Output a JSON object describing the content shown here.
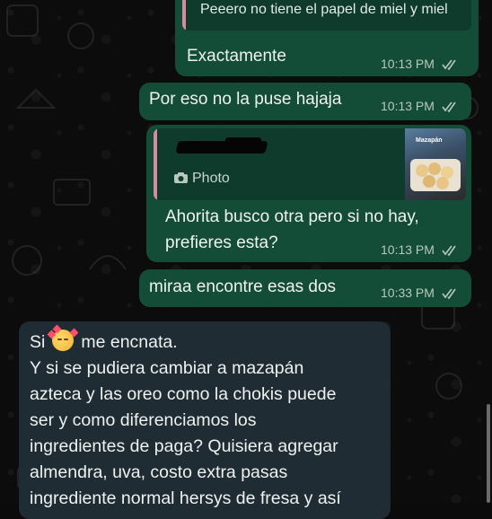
{
  "messages": {
    "quoted_top": "Peeero no tiene el papel de miel y miel",
    "m1": {
      "text": "Exactamente",
      "time": "10:13 PM"
    },
    "m2": {
      "text": "Por eso no la puse hajaja",
      "time": "10:13 PM"
    },
    "m3": {
      "quote_label": "Photo",
      "thumb_label": "Mazapán",
      "line1": "Ahorita busco otra pero si no hay,",
      "line2": "prefieres esta?",
      "time": "10:13 PM"
    },
    "m4": {
      "text": "miraa encontre esas dos",
      "time": "10:33 PM"
    },
    "incoming": {
      "line1_a": "Si",
      "line1_b": "me encnata.",
      "line2": "Y si se pudiera cambiar a mazapán",
      "line3": "azteca y las oreo como la chokis  puede",
      "line4": "ser y como diferenciamos los",
      "line5": "ingredientes de paga? Quisiera agregar",
      "line6": "almendra, uva, costo extra pasas",
      "line7": "ingrediente normal hersys de fresa y así"
    }
  },
  "colors": {
    "outgoing_bubble": "#144d37",
    "incoming_bubble": "#202c33",
    "quote_bar": "#d88aa3"
  }
}
